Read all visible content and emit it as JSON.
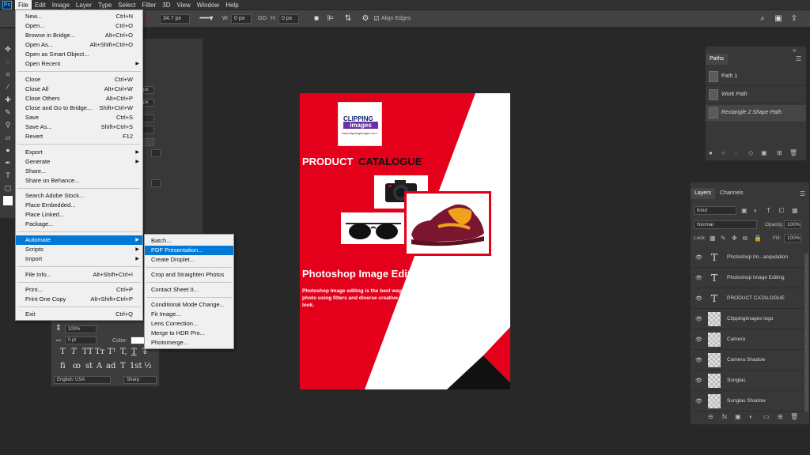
{
  "app": {
    "logo_text": "Ps"
  },
  "menubar": [
    "File",
    "Edit",
    "Image",
    "Layer",
    "Type",
    "Select",
    "Filter",
    "3D",
    "View",
    "Window",
    "Help"
  ],
  "options_bar": {
    "stroke_size": "34.7 px",
    "width_label": "W:",
    "width_value": "0 px",
    "go_label": "GO",
    "height_label": "H:",
    "height_value": "0 px",
    "align_edges": "Align Edges"
  },
  "properties_panel": {
    "values": [
      "9 px",
      "9 px"
    ]
  },
  "file_menu": {
    "items": [
      {
        "label": "New...",
        "shortcut": "Ctrl+N"
      },
      {
        "label": "Open...",
        "shortcut": "Ctrl+O"
      },
      {
        "label": "Browse in Bridge...",
        "shortcut": "Alt+Ctrl+O"
      },
      {
        "label": "Open As...",
        "shortcut": "Alt+Shift+Ctrl+O"
      },
      {
        "label": "Open as Smart Object...",
        "shortcut": ""
      },
      {
        "label": "Open Recent",
        "shortcut": ""
      },
      {
        "label": "Close",
        "shortcut": "Ctrl+W"
      },
      {
        "label": "Close All",
        "shortcut": "Alt+Ctrl+W"
      },
      {
        "label": "Close Others",
        "shortcut": "Alt+Ctrl+P"
      },
      {
        "label": "Close and Go to Bridge...",
        "shortcut": "Shift+Ctrl+W"
      },
      {
        "label": "Save",
        "shortcut": "Ctrl+S"
      },
      {
        "label": "Save As...",
        "shortcut": "Shift+Ctrl+S"
      },
      {
        "label": "Revert",
        "shortcut": "F12"
      },
      {
        "label": "Export",
        "shortcut": ""
      },
      {
        "label": "Generate",
        "shortcut": ""
      },
      {
        "label": "Share...",
        "shortcut": ""
      },
      {
        "label": "Share on Behance...",
        "shortcut": ""
      },
      {
        "label": "Search Adobe Stock...",
        "shortcut": ""
      },
      {
        "label": "Place Embedded...",
        "shortcut": ""
      },
      {
        "label": "Place Linked...",
        "shortcut": ""
      },
      {
        "label": "Package...",
        "shortcut": ""
      },
      {
        "label": "Automate",
        "shortcut": ""
      },
      {
        "label": "Scripts",
        "shortcut": ""
      },
      {
        "label": "Import",
        "shortcut": ""
      },
      {
        "label": "File Info...",
        "shortcut": "Alt+Shift+Ctrl+I"
      },
      {
        "label": "Print...",
        "shortcut": "Ctrl+P"
      },
      {
        "label": "Print One Copy",
        "shortcut": "Alt+Shift+Ctrl+P"
      },
      {
        "label": "Exit",
        "shortcut": "Ctrl+Q"
      }
    ]
  },
  "automate_menu": {
    "items": [
      "Batch...",
      "PDF Presentation...",
      "Create Droplet...",
      "Crop and Straighten Photos",
      "Contact Sheet II...",
      "Conditional Mode Change...",
      "Fit Image...",
      "Lens Correction...",
      "Merge to HDR Pro...",
      "Photomerge..."
    ]
  },
  "character_panel": {
    "leading": "100%",
    "tracking": "0 pt",
    "color_label": "Color:",
    "language": "English: USA",
    "antialias": "Sharp",
    "glyphs": [
      "T",
      "T",
      "TT",
      "Tт",
      "T¹",
      "T,",
      "T",
      "T̶"
    ],
    "glyphs2": [
      "fi",
      "ꝏ",
      "st",
      "A",
      "ad",
      "T",
      "1st",
      "½"
    ]
  },
  "document": {
    "logo_top": "CLIPPING",
    "logo_mid": "images",
    "logo_url": "www.clippingimages.com",
    "title_a": "PRODUCT",
    "title_b": "CATALOGUE",
    "headline": "Photoshop Image Editing",
    "body": "Photoshop Image editing is the best way to define manipulation of a photo using filters and diverse creative effects and give it an explicit look."
  },
  "paths_panel": {
    "tab": "Paths",
    "rows": [
      "Path 1",
      "Work Path",
      "Rectangle 2 Shape Path"
    ]
  },
  "layers_panel": {
    "tabs": [
      "Layers",
      "Channels"
    ],
    "kind": "Kind",
    "blend": "Normal",
    "opacity_label": "Opacity:",
    "opacity": "100%",
    "lock_label": "Lock:",
    "fill_label": "Fill:",
    "fill": "100%",
    "layers": [
      {
        "name": "Photoshop Im...anipulation",
        "type": "text"
      },
      {
        "name": "Photoshop Image Editing",
        "type": "text"
      },
      {
        "name": "PRODUCT CATALOGUE",
        "type": "text"
      },
      {
        "name": "Clippingimages logo",
        "type": "image"
      },
      {
        "name": "Camera",
        "type": "image"
      },
      {
        "name": "Camera  Shadow",
        "type": "image"
      },
      {
        "name": "Sunglas",
        "type": "image"
      },
      {
        "name": "Sunglas Shadow",
        "type": "image"
      }
    ]
  },
  "colors": {
    "accent": "#0078d7",
    "doc_red": "#e4001b",
    "panel": "#383838",
    "bg": "#282828"
  }
}
